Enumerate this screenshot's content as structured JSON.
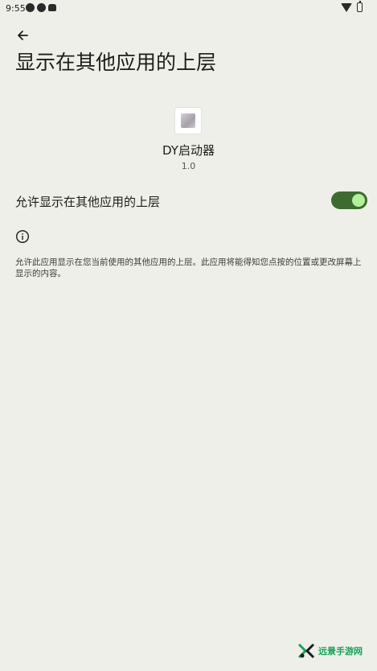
{
  "status_bar": {
    "time": "9:55"
  },
  "page": {
    "title": "显示在其他应用的上层"
  },
  "app": {
    "name": "DY启动器",
    "version": "1.0"
  },
  "permission": {
    "label": "允许显示在其他应用的上层",
    "enabled": true,
    "accent_color": "#3e6b30"
  },
  "info": {
    "description": "允许此应用显示在您当前使用的其他应用的上层。此应用将能得知您点按的位置或更改屏幕上显示的内容。"
  },
  "watermark": {
    "text": "远景手游网"
  }
}
